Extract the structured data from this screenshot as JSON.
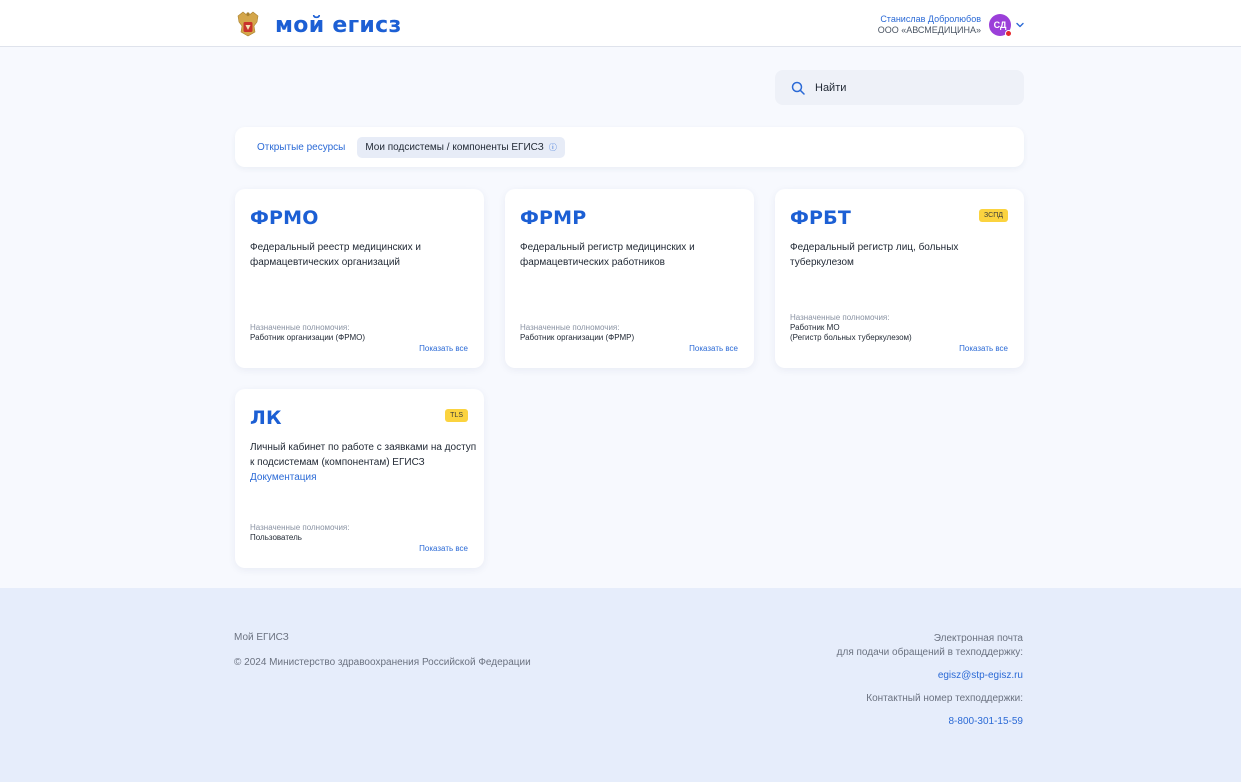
{
  "header": {
    "logo_text": "мой егисз",
    "user_name": "Станислав Добролюбов",
    "user_org": "ООО «АВСМЕДИЦИНА»",
    "avatar_initials": "СД"
  },
  "search": {
    "placeholder": "Найти"
  },
  "tabs": [
    {
      "label": "Открытые ресурсы"
    },
    {
      "label": "Мои подсистемы / компоненты ЕГИСЗ"
    }
  ],
  "cards": [
    {
      "title": "ФРМО",
      "badge": "",
      "description": "Федеральный реестр медицинских и фармацевтических организаций",
      "doc_link": "",
      "perm_label": "Назначенные полномочия:",
      "perm_value_1": "Работник организации (ФРМО)",
      "perm_value_2": "",
      "show_all": "Показать все"
    },
    {
      "title": "ФРМР",
      "badge": "",
      "description": "Федеральный регистр медицинских и фармацевтических работников",
      "doc_link": "",
      "perm_label": "Назначенные полномочия:",
      "perm_value_1": "Работник организации (ФРМР)",
      "perm_value_2": "",
      "show_all": "Показать все"
    },
    {
      "title": "ФРБТ",
      "badge": "ЗСПД",
      "description": "Федеральный регистр лиц, больных туберкулезом",
      "doc_link": "",
      "perm_label": "Назначенные полномочия:",
      "perm_value_1": "Работник МО",
      "perm_value_2": "(Регистр больных туберкулезом)",
      "show_all": "Показать все"
    },
    {
      "title": "ЛК",
      "badge": "TLS",
      "description": "Личный кабинет по работе с заявками на доступ к подсистемам (компонентам) ЕГИСЗ",
      "doc_link": "Документация",
      "perm_label": "Назначенные полномочия:",
      "perm_value_1": "Пользователь",
      "perm_value_2": "",
      "show_all": "Показать все"
    }
  ],
  "footer": {
    "brand": "Мой ЕГИСЗ",
    "copyright": "© 2024 Министерство здравоохранения Российской Федерации",
    "email_label_1": "Электронная почта",
    "email_label_2": "для подачи обращений в техподдержку:",
    "email": "egisz@stp-egisz.ru",
    "phone_label": "Контактный номер техподдержки:",
    "phone": "8-800-301-15-59"
  },
  "colors": {
    "brand_blue": "#1c5fd4",
    "link_blue": "#2b6ad6",
    "badge_yellow": "#fbd33f",
    "avatar_purple": "#9b3fd9",
    "footer_bg": "#e6edfb"
  },
  "icons": {
    "emblem": "coat-of-arms-icon",
    "search": "search-icon",
    "chevron": "chevron-down-icon",
    "info": "info-icon"
  }
}
